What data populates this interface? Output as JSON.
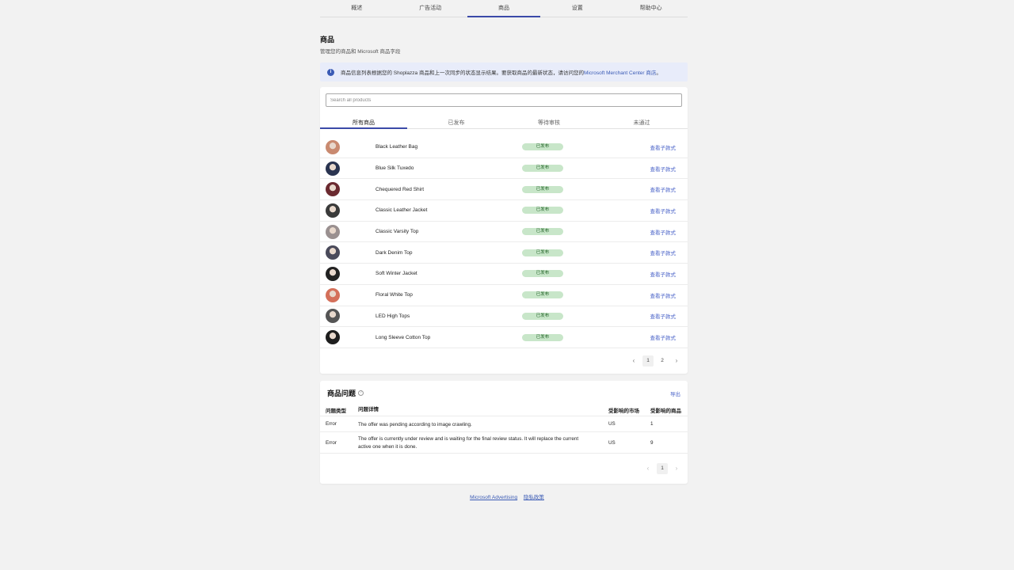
{
  "nav": {
    "tabs": [
      {
        "label": "概述"
      },
      {
        "label": "广告活动"
      },
      {
        "label": "商品",
        "active": true
      },
      {
        "label": "设置"
      },
      {
        "label": "帮助中心"
      }
    ]
  },
  "page": {
    "title": "商品",
    "subtitle": "管理您的商品和 Microsoft 商品字段"
  },
  "banner": {
    "icon": "info-icon",
    "text": "商品信息列表根据您的 Shoplazza 商品和上一次同步的状态显示结果。要获取商品的最新状态，请访问您的",
    "link": "Microsoft Merchant Center 商店",
    "suffix": "。"
  },
  "products": {
    "search_placeholder": "Search all products",
    "tabs": [
      {
        "label": "所有商品",
        "active": true
      },
      {
        "label": "已发布"
      },
      {
        "label": "等待审核"
      },
      {
        "label": "未通过"
      }
    ],
    "rows": [
      {
        "name": "Black Leather Bag",
        "status": "已发布",
        "action": "查看子款式",
        "avatar_color": "#c98a70"
      },
      {
        "name": "Blue Silk Tuxedo",
        "status": "已发布",
        "action": "查看子款式",
        "avatar_color": "#2a3450"
      },
      {
        "name": "Chequered Red Shirt",
        "status": "已发布",
        "action": "查看子款式",
        "avatar_color": "#6b2a30"
      },
      {
        "name": "Classic Leather Jacket",
        "status": "已发布",
        "action": "查看子款式",
        "avatar_color": "#3a3a3a"
      },
      {
        "name": "Classic Varsity Top",
        "status": "已发布",
        "action": "查看子款式",
        "avatar_color": "#9a9090"
      },
      {
        "name": "Dark Denim Top",
        "status": "已发布",
        "action": "查看子款式",
        "avatar_color": "#4a4a5a"
      },
      {
        "name": "Soft Winter Jacket",
        "status": "已发布",
        "action": "查看子款式",
        "avatar_color": "#222222"
      },
      {
        "name": "Floral White Top",
        "status": "已发布",
        "action": "查看子款式",
        "avatar_color": "#d4705a"
      },
      {
        "name": "LED High Tops",
        "status": "已发布",
        "action": "查看子款式",
        "avatar_color": "#555555"
      },
      {
        "name": "Long Sleeve Cotton Top",
        "status": "已发布",
        "action": "查看子款式",
        "avatar_color": "#1e1e1e"
      }
    ],
    "pagination": {
      "pages": [
        "1",
        "2"
      ],
      "current": "1"
    }
  },
  "issues": {
    "title": "商品问题",
    "export_label": "导出",
    "columns": [
      "问题类型",
      "问题详情",
      "受影响的市场",
      "受影响的商品"
    ],
    "rows": [
      {
        "type": "Error",
        "detail": "The offer was pending according to image crawling.",
        "market": "US",
        "count": "1"
      },
      {
        "type": "Error",
        "detail": "The offer is currently under review and is waiting for the final review status. It will replace the current active one when it is done.",
        "market": "US",
        "count": "9"
      }
    ],
    "pagination": {
      "pages": [
        "1"
      ],
      "current": "1"
    }
  },
  "footer": {
    "links": [
      "Microsoft Advertising",
      "隐私政策"
    ]
  },
  "colors": {
    "accent": "#3b4aa8",
    "link": "#4a63c8",
    "badge_bg": "#c8e6c9",
    "banner_bg": "#e8ecfa"
  }
}
